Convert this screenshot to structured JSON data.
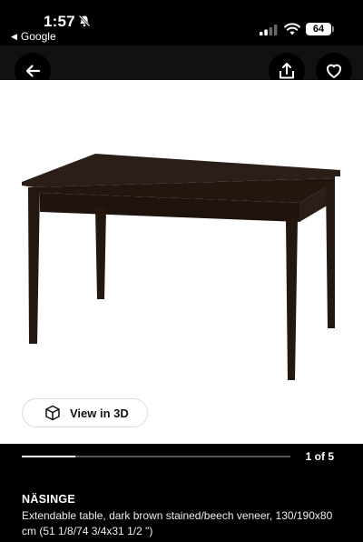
{
  "status": {
    "time": "1:57",
    "back_app": "Google",
    "battery": "64"
  },
  "icons": {
    "back": "arrow-left-icon",
    "share": "share-icon",
    "favorite": "heart-icon",
    "view3d": "cube-icon",
    "silent": "bell-slash-icon"
  },
  "media": {
    "view_3d_label": "View in 3D",
    "pager_label": "1 of 5",
    "current_index": 1,
    "total": 5
  },
  "product": {
    "name": "NÄSINGE",
    "description": "Extendable table, dark brown stained/beech veneer, 130/190x80 cm (51 1/8/74 3/4x31 1/2 \")"
  },
  "colors": {
    "table": "#2b1d17",
    "background": "#000000"
  }
}
